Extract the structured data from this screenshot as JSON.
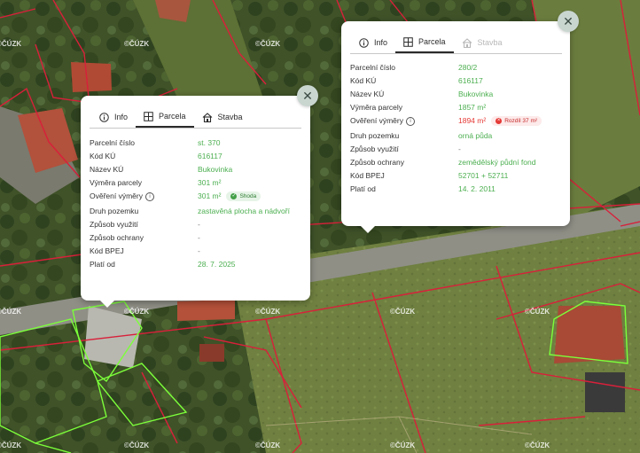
{
  "watermark": "©ČÚZK",
  "popup_left": {
    "close_label": "✕",
    "tabs": [
      {
        "label": "Info",
        "state": "normal"
      },
      {
        "label": "Parcela",
        "state": "active"
      },
      {
        "label": "Stavba",
        "state": "normal"
      }
    ],
    "rows": [
      {
        "key": "Parcelní číslo",
        "value": "st. 370"
      },
      {
        "key": "Kód KÚ",
        "value": "616117"
      },
      {
        "key": "Název KÚ",
        "value": "Bukovinka"
      },
      {
        "key": "Výměra parcely",
        "value": "301 m²"
      },
      {
        "key": "Ověření výměry",
        "value": "301 m²",
        "badge": "Shoda"
      },
      {
        "key": "Druh pozemku",
        "value": "zastavěná plocha a nádvoří"
      },
      {
        "key": "Způsob využití",
        "value": "-"
      },
      {
        "key": "Způsob ochrany",
        "value": "-"
      },
      {
        "key": "Kód BPEJ",
        "value": "-"
      },
      {
        "key": "Platí od",
        "value": "28. 7. 2025"
      }
    ]
  },
  "popup_right": {
    "close_label": "✕",
    "tabs": [
      {
        "label": "Info",
        "state": "normal"
      },
      {
        "label": "Parcela",
        "state": "active"
      },
      {
        "label": "Stavba",
        "state": "disabled"
      }
    ],
    "rows": [
      {
        "key": "Parcelní číslo",
        "value": "280/2"
      },
      {
        "key": "Kód KÚ",
        "value": "616117"
      },
      {
        "key": "Název KÚ",
        "value": "Bukovinka"
      },
      {
        "key": "Výměra parcely",
        "value": "1857 m²"
      },
      {
        "key": "Ověření výměry",
        "value": "1894 m²",
        "badge": "Rozdíl 37 m²"
      },
      {
        "key": "Druh pozemku",
        "value": "orná půda"
      },
      {
        "key": "Způsob využití",
        "value": "-"
      },
      {
        "key": "Způsob ochrany",
        "value": "zemědělský půdní fond"
      },
      {
        "key": "Kód BPEJ",
        "value": "52701 + 52711"
      },
      {
        "key": "Platí od",
        "value": "14. 2. 2011"
      }
    ]
  },
  "colors": {
    "value_green": "#4caf50",
    "value_red": "#e53935",
    "parcel_red": "#d8203a",
    "parcel_green": "#7cff3a"
  }
}
